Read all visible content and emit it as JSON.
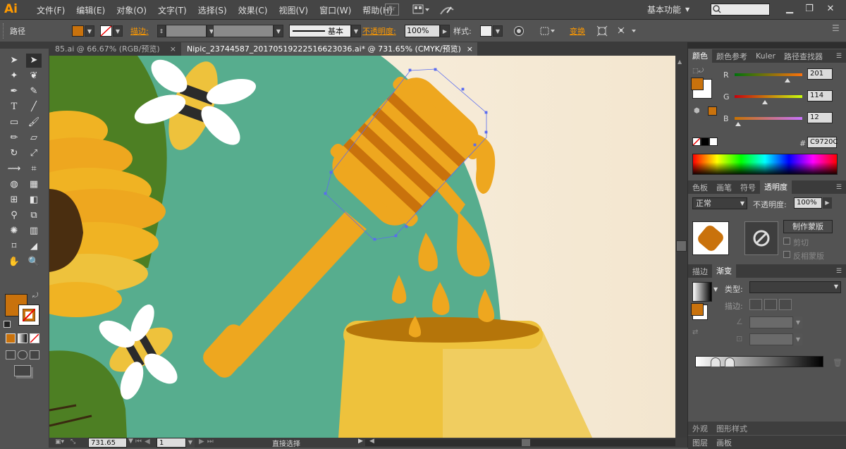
{
  "app": {
    "logo": "Ai",
    "menu": [
      "文件(F)",
      "编辑(E)",
      "对象(O)",
      "文字(T)",
      "选择(S)",
      "效果(C)",
      "视图(V)",
      "窗口(W)",
      "帮助(H)"
    ],
    "workspace": "基本功能",
    "br_label": "Br"
  },
  "control": {
    "object_type": "路径",
    "stroke_label": "描边:",
    "stroke_style": "基本",
    "opacity_label": "不透明度:",
    "opacity_value": "100%",
    "style_label": "样式:",
    "transform_label": "变换",
    "fill_color": "#c9720c"
  },
  "doc_tabs": [
    {
      "label": "85.ai @ 66.67% (RGB/预览)",
      "close": "×"
    },
    {
      "label": "Nipic_23744587_20170519222516623036.ai* @ 731.65% (CMYK/预览)",
      "close": "×"
    }
  ],
  "status": {
    "zoom": "731.65",
    "page": "1",
    "tool_name": "直接选择"
  },
  "color_panel": {
    "tabs": [
      "颜色",
      "颜色参考",
      "Kuler",
      "路径查找器"
    ],
    "r_label": "R",
    "g_label": "G",
    "b_label": "B",
    "r": 201,
    "g": 114,
    "b": 12,
    "hex_label": "#",
    "hex": "C9720C"
  },
  "transparency_panel": {
    "tabs": [
      "色板",
      "画笔",
      "符号",
      "透明度"
    ],
    "blend_mode": "正常",
    "opacity_label": "不透明度:",
    "opacity_value": "100%",
    "make_mask": "制作蒙版",
    "clip": "剪切",
    "invert_mask": "反相蒙版"
  },
  "gradient_panel": {
    "tabs": [
      "描边",
      "渐变"
    ],
    "type_label": "类型:",
    "stroke_label": "描边:"
  },
  "bottom_panels": {
    "row1": [
      "外观",
      "图形样式"
    ],
    "row2": [
      "图层",
      "画板"
    ]
  },
  "colors": {
    "accent": "#ff9a00",
    "fill": "#c9720c",
    "teal": "#57ad8e",
    "honey": "#eea71f",
    "honey_dark": "#c9720c",
    "pot": "#eec23c",
    "cream": "#f7ead6",
    "leaf": "#4d7f23"
  }
}
